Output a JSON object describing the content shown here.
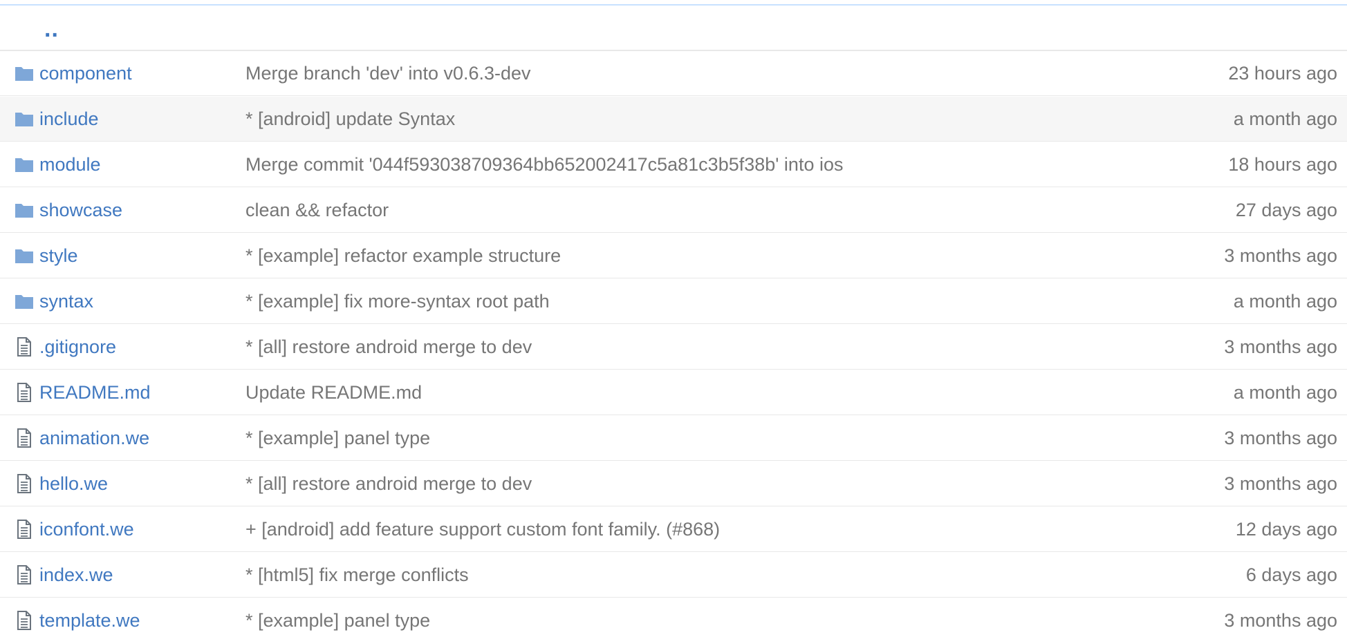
{
  "up_link": "..",
  "colors": {
    "link": "#4078c0",
    "muted": "#767676",
    "folder_icon": "#7ea7d8",
    "file_icon": "#6a737d",
    "highlight_row": "#f6f6f6"
  },
  "rows": [
    {
      "type": "folder",
      "icon": "folder-icon",
      "name": "component",
      "message": "Merge branch 'dev' into v0.6.3-dev",
      "age": "23 hours ago"
    },
    {
      "type": "folder",
      "icon": "folder-icon",
      "name": "include",
      "message": "* [android] update Syntax",
      "age": "a month ago"
    },
    {
      "type": "folder",
      "icon": "folder-icon",
      "name": "module",
      "message": "Merge commit '044f593038709364bb652002417c5a81c3b5f38b' into ios",
      "age": "18 hours ago"
    },
    {
      "type": "folder",
      "icon": "folder-icon",
      "name": "showcase",
      "message": "clean && refactor",
      "age": "27 days ago"
    },
    {
      "type": "folder",
      "icon": "folder-icon",
      "name": "style",
      "message": "* [example] refactor example structure",
      "age": "3 months ago"
    },
    {
      "type": "folder",
      "icon": "folder-icon",
      "name": "syntax",
      "message": "* [example] fix more-syntax root path",
      "age": "a month ago"
    },
    {
      "type": "file",
      "icon": "file-icon",
      "name": ".gitignore",
      "message": "* [all] restore android merge to dev",
      "age": "3 months ago"
    },
    {
      "type": "file",
      "icon": "file-icon",
      "name": "README.md",
      "message": "Update README.md",
      "age": "a month ago"
    },
    {
      "type": "file",
      "icon": "file-icon",
      "name": "animation.we",
      "message": "* [example] panel type",
      "age": "3 months ago"
    },
    {
      "type": "file",
      "icon": "file-icon",
      "name": "hello.we",
      "message": "* [all] restore android merge to dev",
      "age": "3 months ago"
    },
    {
      "type": "file",
      "icon": "file-icon",
      "name": "iconfont.we",
      "message": "+ [android] add feature support custom font family. (#868)",
      "age": "12 days ago"
    },
    {
      "type": "file",
      "icon": "file-icon",
      "name": "index.we",
      "message": "* [html5] fix merge conflicts",
      "age": "6 days ago"
    },
    {
      "type": "file",
      "icon": "file-icon",
      "name": "template.we",
      "message": "* [example] panel type",
      "age": "3 months ago"
    }
  ]
}
